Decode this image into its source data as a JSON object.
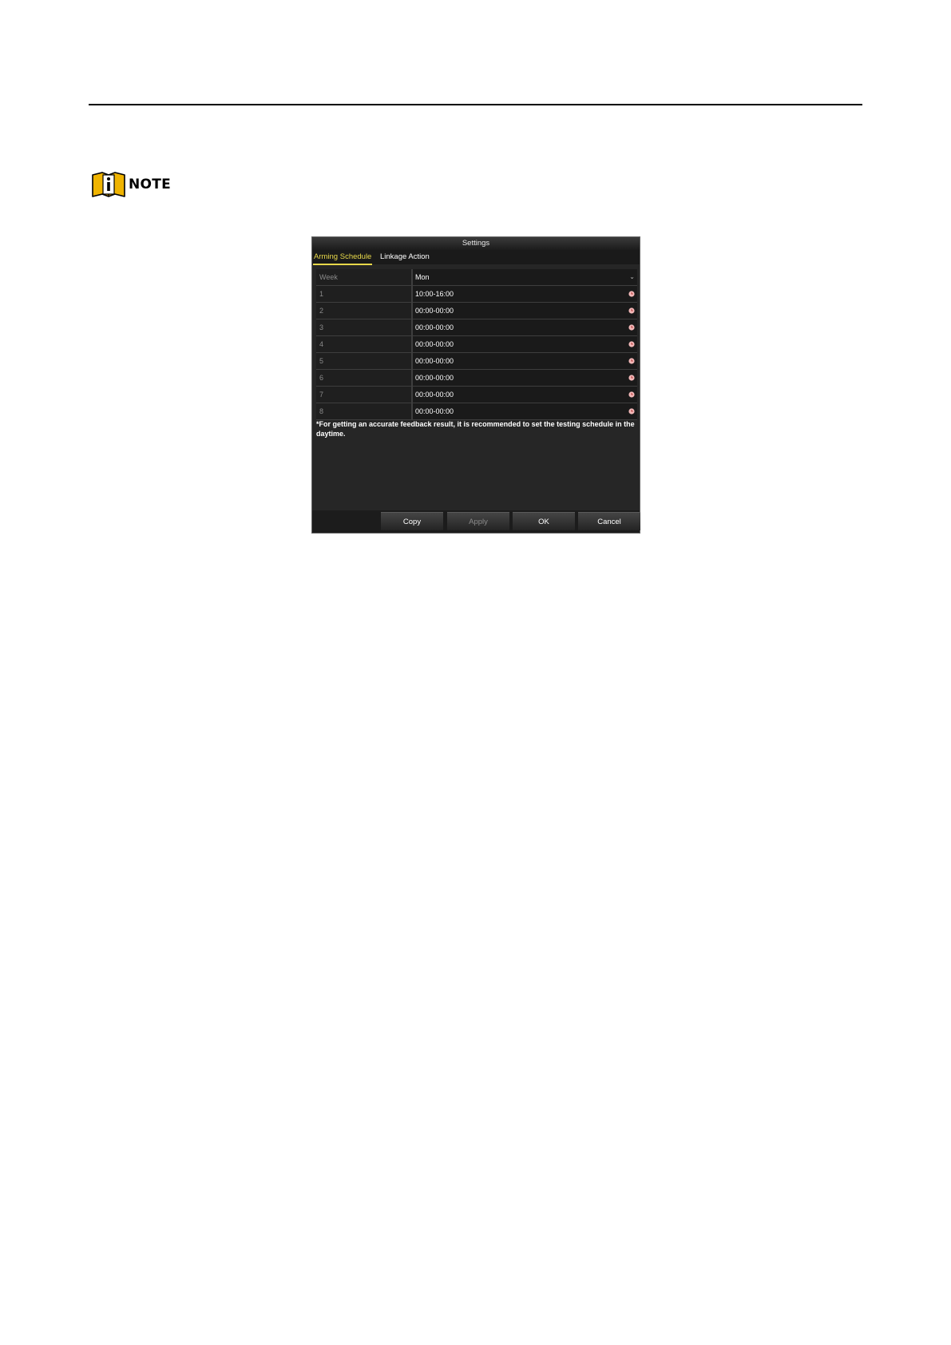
{
  "note": {
    "label": "NOTE"
  },
  "dialog": {
    "title": "Settings",
    "tabs": [
      {
        "label": "Arming Schedule",
        "active": true
      },
      {
        "label": "Linkage Action",
        "active": false
      }
    ],
    "week": {
      "label": "Week",
      "value": "Mon"
    },
    "schedule": [
      {
        "index": "1",
        "period": "10:00-16:00"
      },
      {
        "index": "2",
        "period": "00:00-00:00"
      },
      {
        "index": "3",
        "period": "00:00-00:00"
      },
      {
        "index": "4",
        "period": "00:00-00:00"
      },
      {
        "index": "5",
        "period": "00:00-00:00"
      },
      {
        "index": "6",
        "period": "00:00-00:00"
      },
      {
        "index": "7",
        "period": "00:00-00:00"
      },
      {
        "index": "8",
        "period": "00:00-00:00"
      }
    ],
    "hint": "*For getting an accurate feedback result, it is recommended to set the testing schedule in the daytime.",
    "buttons": {
      "copy": "Copy",
      "apply": "Apply",
      "ok": "OK",
      "cancel": "Cancel"
    }
  },
  "colors": {
    "active_tab": "#e8d94a",
    "dialog_bg": "#262626",
    "note_icon": "#f0b400",
    "clock_icon": "#f2b8b8"
  }
}
